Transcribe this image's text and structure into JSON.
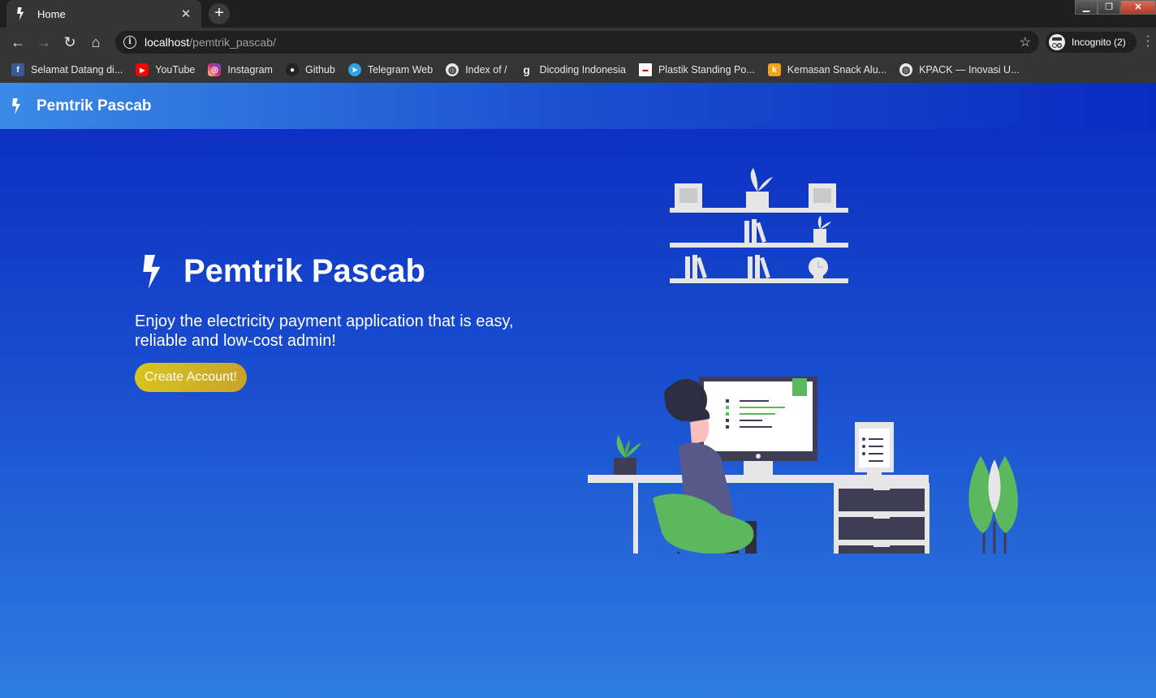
{
  "browser": {
    "tab_title": "Home",
    "tab_close": "✕",
    "new_tab": "+",
    "url_host": "localhost",
    "url_path": "/pemtrik_pascab/",
    "incognito_label": "Incognito (2)",
    "bookmarks": [
      {
        "label": "Selamat Datang di...",
        "icon": "facebook-icon",
        "color": "#3b5998"
      },
      {
        "label": "YouTube",
        "icon": "youtube-icon",
        "color": "#ff0000"
      },
      {
        "label": "Instagram",
        "icon": "instagram-icon",
        "color": "#d62976"
      },
      {
        "label": "Github",
        "icon": "github-icon",
        "color": "#222222"
      },
      {
        "label": "Telegram Web",
        "icon": "telegram-icon",
        "color": "#2ca5e0"
      },
      {
        "label": "Index of /",
        "icon": "globe-icon",
        "color": "#e8e8e8"
      },
      {
        "label": "Dicoding Indonesia",
        "icon": "dicoding-icon",
        "color": "#353535"
      },
      {
        "label": "Plastik Standing Po...",
        "icon": "plastik-icon",
        "color": "#ffffff"
      },
      {
        "label": "Kemasan Snack Alu...",
        "icon": "kemasan-icon",
        "color": "#f7a21b"
      },
      {
        "label": "KPACK — Inovasi U...",
        "icon": "globe-icon",
        "color": "#e8e8e8"
      }
    ]
  },
  "navbar": {
    "brand": "Pemtrik Pascab"
  },
  "hero": {
    "title": "Pemtrik Pascab",
    "subtitle": "Enjoy the electricity payment application that is easy, reliable and low-cost admin!",
    "cta_label": "Create Account!"
  },
  "colors": {
    "page_top": "#0a2bbf",
    "page_bottom": "#2e7de0",
    "cta": "#d8c51e",
    "plant_green": "#5cb85c",
    "furniture": "#e6e6e6",
    "drawer": "#3f3d56"
  }
}
